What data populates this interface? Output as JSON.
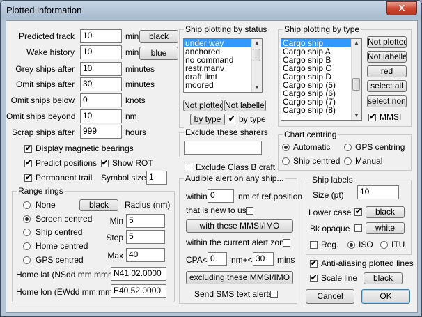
{
  "window": {
    "title": "Plotted information",
    "close": "X"
  },
  "left": {
    "predicted_track": {
      "label": "Predicted track",
      "value": "10",
      "unit": "min",
      "color_button": "black"
    },
    "wake_history": {
      "label": "Wake history",
      "value": "10",
      "unit": "min",
      "color_button": "blue"
    },
    "grey_ships": {
      "label": "Grey ships after",
      "value": "10",
      "unit": "minutes"
    },
    "omit_ships_after": {
      "label": "Omit ships after",
      "value": "30",
      "unit": "minutes"
    },
    "omit_below": {
      "label": "Omit ships below",
      "value": "0",
      "unit": "knots"
    },
    "omit_beyond": {
      "label": "Omit ships beyond",
      "value": "10",
      "unit": "nm"
    },
    "scrap_ships": {
      "label": "Scrap ships after",
      "value": "999",
      "unit": "hours"
    },
    "display_magnetic": {
      "label": "Display magnetic bearings",
      "checked": true
    },
    "predict_positions": {
      "label": "Predict positions",
      "checked": true
    },
    "show_rot": {
      "label": "Show ROT",
      "checked": true
    },
    "permanent_trail": {
      "label": "Permanent trail",
      "checked": true
    },
    "symbol_size": {
      "label": "Symbol size",
      "value": "1"
    }
  },
  "range_rings": {
    "title": "Range rings",
    "options": [
      "None",
      "Screen centred",
      "Ship centred",
      "Home centred",
      "GPS centred"
    ],
    "selected": "Screen centred",
    "color_button": "black",
    "radius_label": "Radius (nm)",
    "min_label": "Min",
    "min_value": "5",
    "step_label": "Step",
    "step_value": "5",
    "max_label": "Max",
    "max_value": "40",
    "home_lat_label": "Home lat (NSdd mm.mmm)",
    "home_lat_value": "N41 02.0000",
    "home_lon_label": "Home lon (EWdd mm.mmm)",
    "home_lon_value": "E40 52.0000"
  },
  "status_group": {
    "title": "Ship plotting by status",
    "items": [
      "under way",
      "anchored",
      "no command",
      "restr.manv",
      "draft limt",
      "moored"
    ],
    "selected": "under way",
    "not_plotted": "Not plotted",
    "not_labelled": "Not labelled",
    "by_type_button": "by type",
    "by_type_check": {
      "label": "by type",
      "checked": true
    }
  },
  "type_group": {
    "title": "Ship plotting by type",
    "items": [
      "Cargo ship",
      "Cargo ship A",
      "Cargo ship B",
      "Cargo ship C",
      "Cargo ship D",
      "Cargo ship (5)",
      "Cargo ship (6)",
      "Cargo ship (7)",
      "Cargo ship (8)"
    ],
    "selected": "Cargo ship",
    "not_plotted": "Not plotted",
    "not_labelled": "Not labelled",
    "red": "red",
    "select_all": "select all",
    "select_none": "select none",
    "mmsi": {
      "label": "MMSI",
      "checked": true
    }
  },
  "exclude": {
    "title": "Exclude these sharers",
    "value": "",
    "class_b": {
      "label": "Exclude Class B craft",
      "checked": false
    }
  },
  "alert": {
    "title": "Audible alert on any ship...",
    "within_label": "within",
    "within_value": "0",
    "within_unit": "nm of ref.position",
    "new_label": "that is new to us",
    "new_checked": false,
    "with_mmsi_button": "with these MMSI/IMO",
    "zone_label": "within the current alert zone",
    "zone_checked": false,
    "cpa_label": "CPA<",
    "cpa_value": "0",
    "nm_label": "nm+<",
    "mins_value": "30",
    "mins_label": "mins",
    "excluding_button": "excluding these MMSI/IMO",
    "sms_label": "Send SMS text alerts",
    "sms_checked": false
  },
  "chart_centring": {
    "title": "Chart centring",
    "options": [
      "Automatic",
      "GPS centring",
      "Ship centred",
      "Manual"
    ],
    "selected": "Automatic"
  },
  "ship_labels": {
    "title": "Ship labels",
    "size_label": "Size (pt)",
    "size_value": "10",
    "lower_case": {
      "label": "Lower case",
      "checked": true,
      "color_button": "black"
    },
    "bk_opaque": {
      "label": "Bk opaque",
      "checked": false,
      "color_button": "white"
    },
    "reg": {
      "label": "Reg.",
      "checked": false
    },
    "iso": {
      "label": "ISO",
      "selected": true
    },
    "itu": {
      "label": "ITU",
      "selected": false
    }
  },
  "anti_aliasing": {
    "label": "Anti-aliasing plotted lines",
    "checked": true
  },
  "scale_line": {
    "label": "Scale line",
    "checked": true,
    "color_button": "black"
  },
  "footer": {
    "cancel": "Cancel",
    "ok": "OK"
  },
  "check_glyph": "✔"
}
